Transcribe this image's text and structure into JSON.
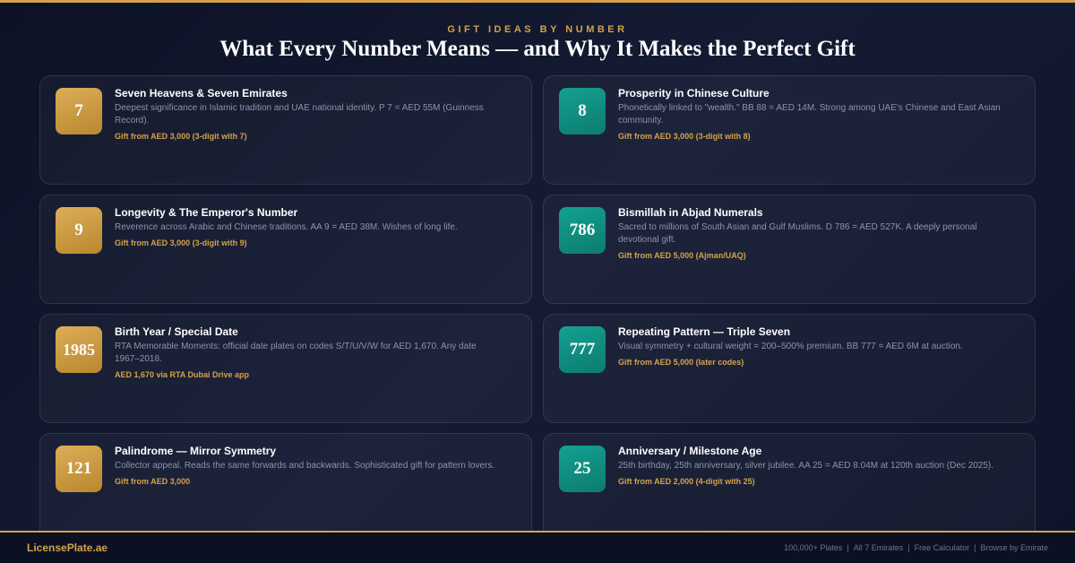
{
  "header": {
    "eyebrow": "GIFT IDEAS BY NUMBER",
    "title": "What Every Number Means — and Why It Makes the Perfect Gift"
  },
  "cards": [
    {
      "number": "7",
      "title": "Seven Heavens & Seven Emirates",
      "description": "Deepest significance in Islamic tradition and UAE national identity. P 7 = AED 55M (Guinness Record).",
      "price": "Gift from AED 3,000 (3-digit with 7)"
    },
    {
      "number": "8",
      "title": "Prosperity in Chinese Culture",
      "description": "Phonetically linked to \"wealth.\" BB 88 = AED 14M. Strong among UAE's Chinese and East Asian community.",
      "price": "Gift from AED 3,000 (3-digit with 8)"
    },
    {
      "number": "9",
      "title": "Longevity & The Emperor's Number",
      "description": "Reverence across Arabic and Chinese traditions. AA 9 = AED 38M. Wishes of long life.",
      "price": "Gift from AED 3,000 (3-digit with 9)"
    },
    {
      "number": "786",
      "title": "Bismillah in Abjad Numerals",
      "description": "Sacred to millions of South Asian and Gulf Muslims. D 786 = AED 527K. A deeply personal devotional gift.",
      "price": "Gift from AED 5,000 (Ajman/UAQ)"
    },
    {
      "number": "1985",
      "title": "Birth Year / Special Date",
      "description": "RTA Memorable Moments: official date plates on codes S/T/U/V/W for AED 1,670. Any date 1967–2018.",
      "price": "AED 1,670 via RTA Dubai Drive app"
    },
    {
      "number": "777",
      "title": "Repeating Pattern — Triple Seven",
      "description": "Visual symmetry + cultural weight = 200–500% premium. BB 777 = AED 6M at auction.",
      "price": "Gift from AED 5,000 (later codes)"
    },
    {
      "number": "121",
      "title": "Palindrome — Mirror Symmetry",
      "description": "Collector appeal. Reads the same forwards and backwards. Sophisticated gift for pattern lovers.",
      "price": "Gift from AED 3,000"
    },
    {
      "number": "25",
      "title": "Anniversary / Milestone Age",
      "description": "25th birthday, 25th anniversary, silver jubilee. AA 25 = AED 8.04M at 120th auction (Dec 2025).",
      "price": "Gift from AED 2,000 (4-digit with 25)"
    }
  ],
  "footer": {
    "brand": "LicensePlate.ae",
    "links": [
      "100,000+ Plates",
      "All 7 Emirates",
      "Free Calculator",
      "Browse by Emirate"
    ]
  },
  "colors": {
    "accent_gold": "#d4a24a",
    "teal": "#0f8f80",
    "background": "#0d1226"
  }
}
